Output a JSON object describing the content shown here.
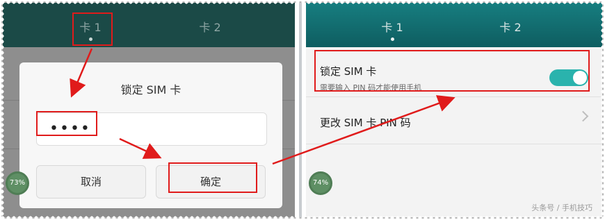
{
  "left_screen": {
    "tabs": [
      {
        "label": "卡 1"
      },
      {
        "label": "卡 2"
      }
    ],
    "dialog": {
      "title": "锁定 SIM 卡",
      "pin_value": "••••",
      "cancel_label": "取消",
      "ok_label": "确定"
    },
    "battery_bubble": "73%"
  },
  "right_screen": {
    "tabs": [
      {
        "label": "卡 1"
      },
      {
        "label": "卡 2"
      }
    ],
    "settings": {
      "lock_sim": {
        "title": "锁定 SIM 卡",
        "subtitle": "需要输入 PIN 码才能使用手机",
        "enabled": true
      },
      "change_pin": {
        "title": "更改 SIM 卡 PIN 码"
      }
    },
    "battery_bubble": "74%"
  },
  "watermark": "头条号 / 手机技巧",
  "colors": {
    "annotation_red": "#e01b1b",
    "toggle_on": "#2ab3ad",
    "tabbar_teal": "#0e5d60"
  },
  "icons": {
    "chevron": "chevron-right-icon",
    "toggle": "toggle-switch-icon"
  }
}
